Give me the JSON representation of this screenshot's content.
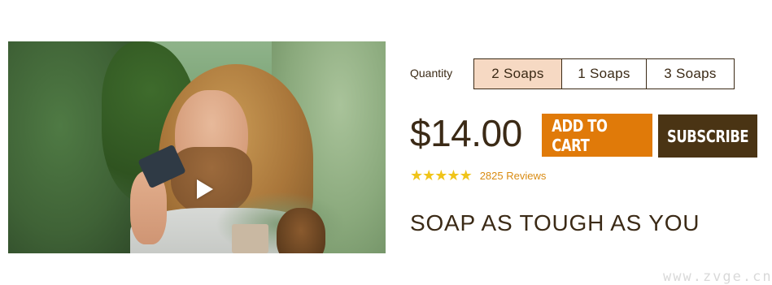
{
  "product": {
    "quantity_label": "Quantity",
    "quantity_options": [
      {
        "label": "2 Soaps",
        "selected": true
      },
      {
        "label": "1 Soaps",
        "selected": false
      },
      {
        "label": "3 Soaps",
        "selected": false
      }
    ],
    "price": "$14.00",
    "add_to_cart_label": "ADD TO CART",
    "subscribe_label": "SUBSCRIBE",
    "rating_stars": 5,
    "reviews_text": "2825 Reviews",
    "headline": "SOAP AS TOUGH AS YOU"
  },
  "video": {
    "icon": "play-icon"
  },
  "watermark": "www.zvge.cn",
  "colors": {
    "accent_orange": "#e07a09",
    "dark_brown": "#4a3414",
    "selected_bg": "#f6d9c3",
    "star": "#f0c419",
    "reviews_link": "#d98b12"
  }
}
